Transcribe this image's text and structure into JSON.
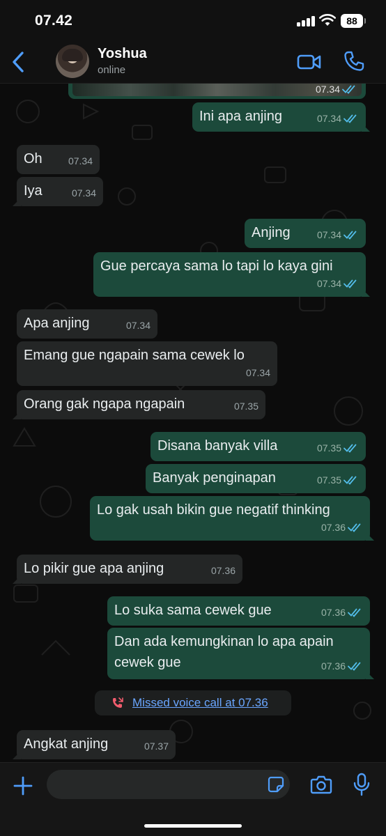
{
  "status_bar": {
    "time": "07.42",
    "battery": "88",
    "signal_icon": "cellular-signal-icon",
    "wifi_icon": "wifi-icon"
  },
  "header": {
    "contact_name": "Yoshua",
    "contact_status": "online",
    "back_icon": "chevron-left-icon",
    "video_icon": "video-camera-icon",
    "call_icon": "phone-icon"
  },
  "colors": {
    "accent": "#4f9dfa",
    "incoming_bubble": "#242626",
    "outgoing_bubble": "#1c4a3b",
    "read_ticks": "#53bdeb",
    "missed_call_red": "#f15c6d"
  },
  "messages": [
    {
      "dir": "out",
      "kind": "photo",
      "time": "07.34"
    },
    {
      "dir": "out",
      "text": "Ini apa anjing",
      "time": "07.34"
    },
    {
      "dir": "in",
      "text": "Oh",
      "time": "07.34"
    },
    {
      "dir": "in",
      "text": "Iya",
      "time": "07.34"
    },
    {
      "dir": "out",
      "text": "Anjing",
      "time": "07.34"
    },
    {
      "dir": "out",
      "text": "Gue percaya sama lo tapi lo kaya gini",
      "time": "07.34"
    },
    {
      "dir": "in",
      "text": "Apa anjing",
      "time": "07.34"
    },
    {
      "dir": "in",
      "text": "Emang gue ngapain sama cewek lo",
      "time": "07.34"
    },
    {
      "dir": "in",
      "text": "Orang gak ngapa ngapain",
      "time": "07.35"
    },
    {
      "dir": "out",
      "text": "Disana banyak villa",
      "time": "07.35"
    },
    {
      "dir": "out",
      "text": "Banyak penginapan",
      "time": "07.35"
    },
    {
      "dir": "out",
      "text": "Lo gak usah bikin gue negatif thinking",
      "time": "07.36"
    },
    {
      "dir": "in",
      "text": "Lo pikir gue apa anjing",
      "time": "07.36"
    },
    {
      "dir": "out",
      "text": "Lo suka sama cewek gue",
      "time": "07.36"
    },
    {
      "dir": "out",
      "text_lines": [
        "Dan ada kemungkinan lo apa apain",
        "cewek gue"
      ],
      "time": "07.36"
    },
    {
      "dir": "in",
      "text": "Angkat anjing",
      "time": "07.37"
    }
  ],
  "missed_call": {
    "text": "Missed voice call at 07.36",
    "icon": "missed-call-icon"
  },
  "input_bar": {
    "placeholder": "",
    "plus_icon": "plus-icon",
    "sticker_icon": "sticker-icon",
    "camera_icon": "camera-icon",
    "mic_icon": "microphone-icon"
  }
}
